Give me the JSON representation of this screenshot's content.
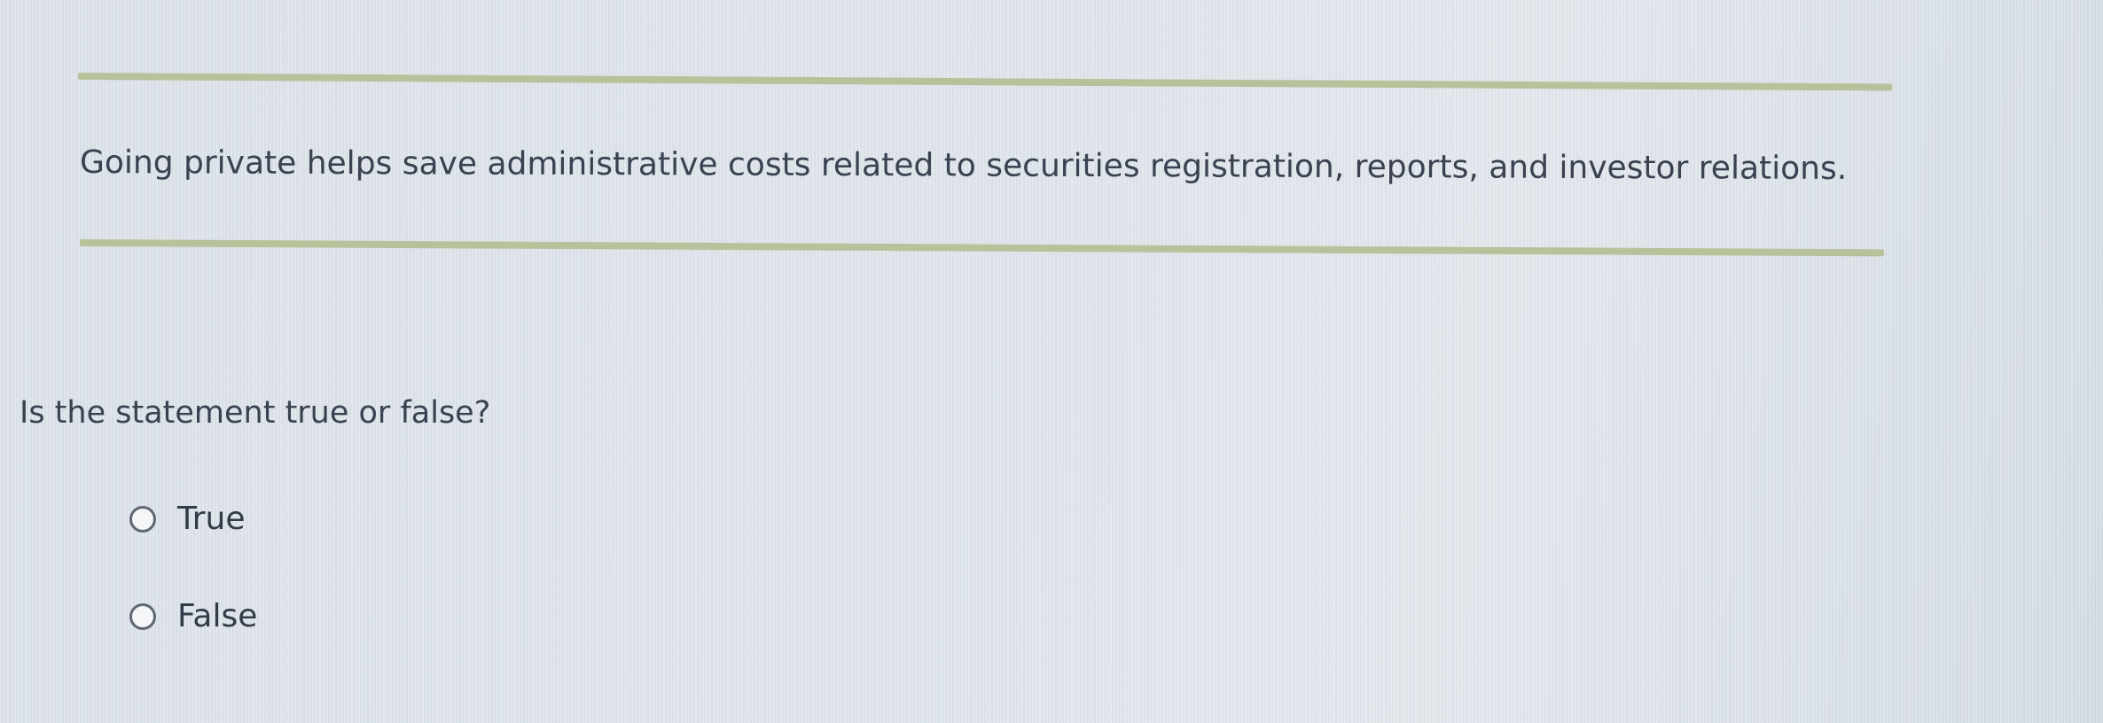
{
  "statement": {
    "text": "Going private helps save administrative costs related to securities registration, reports, and investor relations."
  },
  "question": {
    "prompt": "Is the statement true or false?"
  },
  "options": [
    {
      "label": "True",
      "selected": false
    },
    {
      "label": "False",
      "selected": false
    }
  ],
  "colors": {
    "rule": "#b8c29a",
    "text": "#3a4150",
    "background": "#dfe5ec"
  }
}
